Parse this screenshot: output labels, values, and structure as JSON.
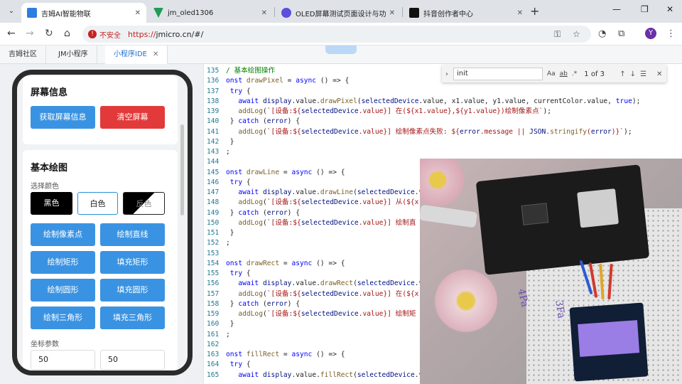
{
  "browser": {
    "tabs": [
      {
        "title": "吉姆AI智能物联",
        "favicon_color": "#2e7de0"
      },
      {
        "title": "jm_oled1306",
        "favicon_color": "#1f9d55"
      },
      {
        "title": "OLED屏幕测试页面设计与功能",
        "favicon_color": "#5b4fdb"
      },
      {
        "title": "抖音创作者中心",
        "favicon_color": "#111111"
      }
    ],
    "insecure_label": "不安全",
    "url_scheme": "https://",
    "url_rest": "jmicro.cn/#/",
    "profile_initial": "Y"
  },
  "app_tabs": [
    {
      "label": "吉姆社区"
    },
    {
      "label": "JM小程序"
    },
    {
      "label": "小程序IDE"
    }
  ],
  "preview": {
    "screen_info": {
      "title": "屏幕信息",
      "get_info": "获取屏幕信息",
      "clear": "清空屏幕"
    },
    "drawing": {
      "title": "基本绘图",
      "color_label": "选择颜色",
      "black": "黑色",
      "white": "白色",
      "invert": "反色",
      "draw_pixel": "绘制像素点",
      "draw_line": "绘制直线",
      "draw_rect": "绘制矩形",
      "fill_rect": "填充矩形",
      "draw_circle": "绘制圆形",
      "fill_circle": "填充圆形",
      "draw_triangle": "绘制三角形",
      "fill_triangle": "填充三角形",
      "coord_label": "坐标参数",
      "x1": "50",
      "y1": "50"
    }
  },
  "find": {
    "query": "init",
    "opt_case": "Aa",
    "opt_word": "ab",
    "opt_regex": ".*",
    "count": "1 of 3"
  },
  "camera": {
    "hand_text_1": "4Pa",
    "hand_text_2": "3Fa"
  },
  "editor": {
    "lines": [
      {
        "n": "135",
        "t": "/ 基本绘图操作"
      },
      {
        "n": "136",
        "t": "onst drawPixel = async () => {"
      },
      {
        "n": "137",
        "t": " try {"
      },
      {
        "n": "138",
        "t": "   await display.value.drawPixel(selectedDevice.value, x1.value, y1.value, currentColor.value, true);"
      },
      {
        "n": "139",
        "t": "   addLog(`[设备:${selectedDevice.value}] 在(${x1.value},${y1.value})绘制像素点`);"
      },
      {
        "n": "140",
        "t": " } catch (error) {"
      },
      {
        "n": "141",
        "t": "   addLog(`[设备:${selectedDevice.value}] 绘制像素点失败: ${error.message || JSON.stringify(error)}`);"
      },
      {
        "n": "142",
        "t": " }"
      },
      {
        "n": "143",
        "t": ";"
      },
      {
        "n": "144",
        "t": ""
      },
      {
        "n": "145",
        "t": "onst drawLine = async () => {"
      },
      {
        "n": "146",
        "t": " try {"
      },
      {
        "n": "147",
        "t": "   await display.value.drawLine(selectedDevice.v"
      },
      {
        "n": "148",
        "t": "   addLog(`[设备:${selectedDevice.value}] 从(${x"
      },
      {
        "n": "149",
        "t": " } catch (error) {"
      },
      {
        "n": "150",
        "t": "   addLog(`[设备:${selectedDevice.value}] 绘制直"
      },
      {
        "n": "151",
        "t": " }"
      },
      {
        "n": "152",
        "t": ";"
      },
      {
        "n": "153",
        "t": ""
      },
      {
        "n": "154",
        "t": "onst drawRect = async () => {"
      },
      {
        "n": "155",
        "t": " try {"
      },
      {
        "n": "156",
        "t": "   await display.value.drawRect(selectedDevice.v"
      },
      {
        "n": "157",
        "t": "   addLog(`[设备:${selectedDevice.value}] 在(${x"
      },
      {
        "n": "158",
        "t": " } catch (error) {"
      },
      {
        "n": "159",
        "t": "   addLog(`[设备:${selectedDevice.value}] 绘制矩"
      },
      {
        "n": "160",
        "t": " }"
      },
      {
        "n": "161",
        "t": ";"
      },
      {
        "n": "162",
        "t": ""
      },
      {
        "n": "163",
        "t": "onst fillRect = async () => {"
      },
      {
        "n": "164",
        "t": " try {"
      },
      {
        "n": "165",
        "t": "   await display.value.fillRect(selectedDevice.v"
      }
    ]
  },
  "colors": {
    "accent_blue": "#3a93e2",
    "danger_red": "#e23a3a",
    "insecure_red": "#c5221f"
  }
}
